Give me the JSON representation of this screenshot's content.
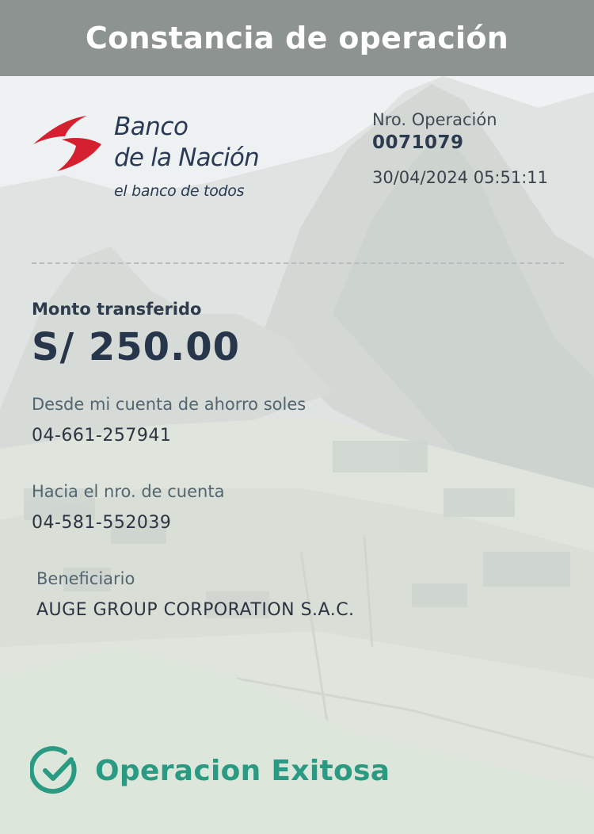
{
  "header": {
    "title": "Constancia de operación"
  },
  "bank": {
    "name_line1": "Banco",
    "name_line2": "de la Nación",
    "tagline": "el banco de todos",
    "logo_color": "#d4202f"
  },
  "operation": {
    "label": "Nro. Operación",
    "number": "0071079",
    "datetime": "30/04/2024 05:51:11"
  },
  "transfer": {
    "amount_label": "Monto transferido",
    "amount": "S/ 250.00",
    "from_label": "Desde mi cuenta de ahorro soles",
    "from_account": "04-661-257941",
    "to_label": "Hacia el nro. de cuenta",
    "to_account": "04-581-552039",
    "beneficiary_label": "Beneficiario",
    "beneficiary": "AUGE GROUP CORPORATION S.A.C."
  },
  "status": {
    "text": "Operacion Exitosa",
    "icon": "check-circle-icon",
    "color": "#2a9a82"
  }
}
